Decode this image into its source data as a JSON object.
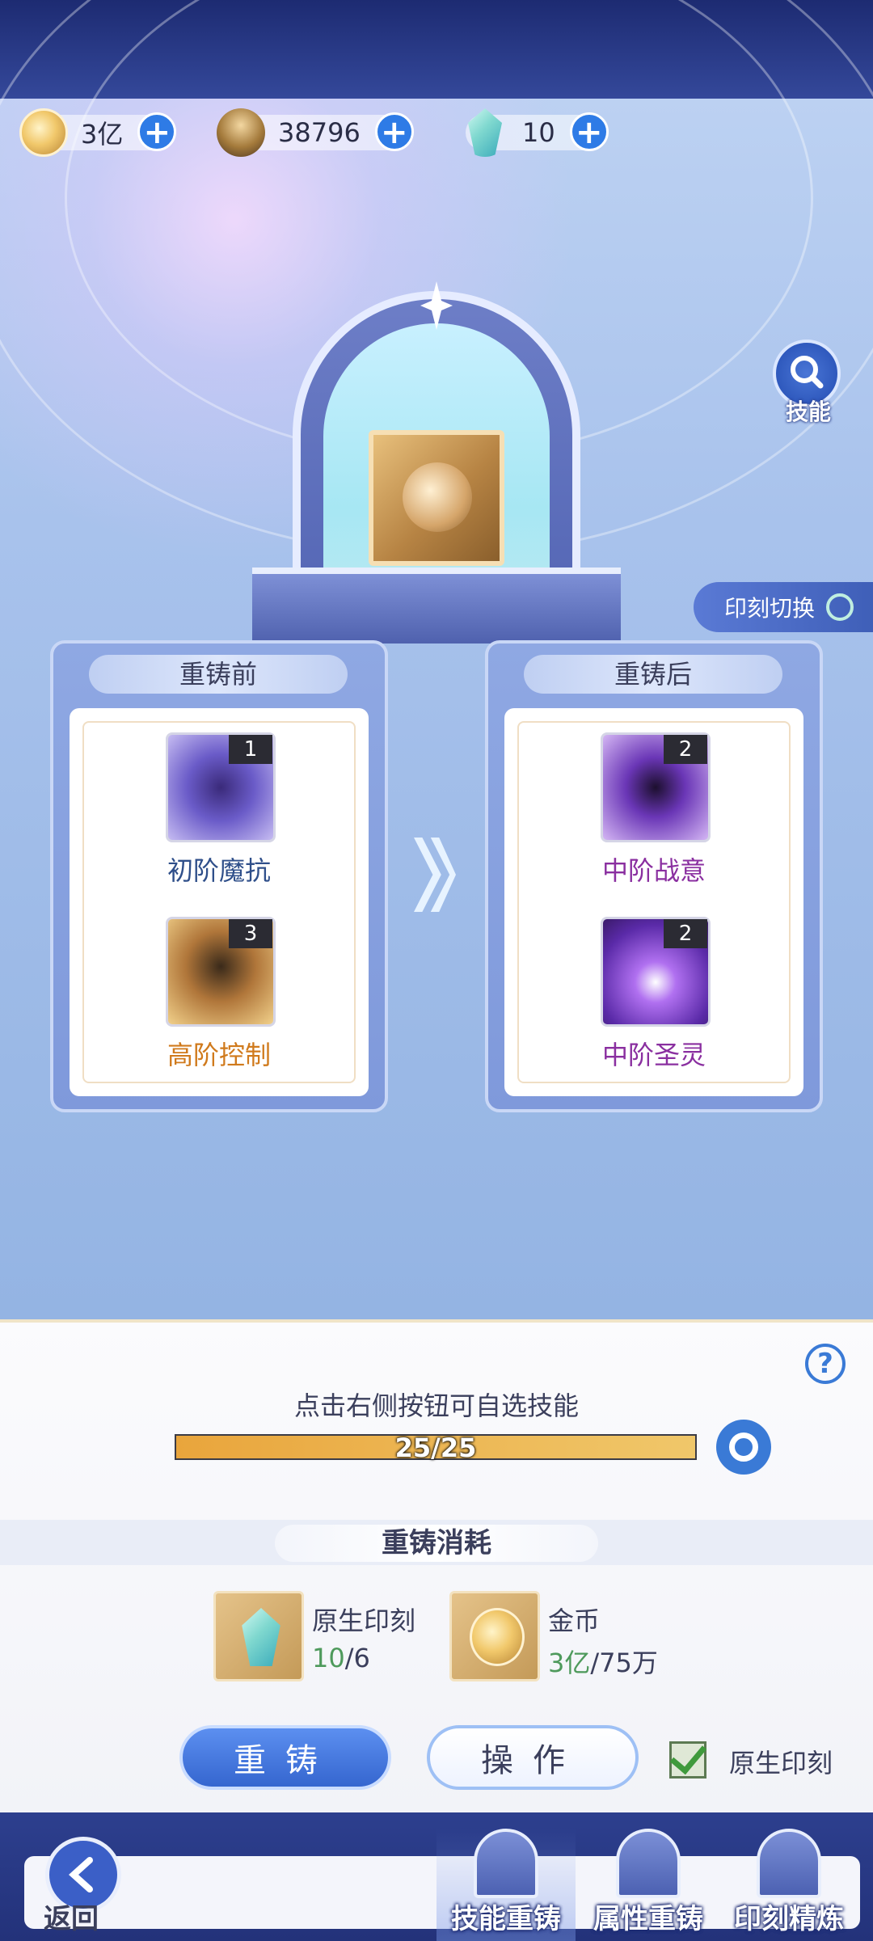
{
  "resources": [
    {
      "icon": "gold-coin-icon",
      "value": "3亿"
    },
    {
      "icon": "reforge-material-icon",
      "value": "38796"
    },
    {
      "icon": "crystal-icon",
      "value": "10"
    }
  ],
  "skill_lookup": {
    "label": "技能"
  },
  "imprint_switch": {
    "label": "印刻切换"
  },
  "before": {
    "title": "重铸前",
    "skills": [
      {
        "name": "初阶魔抗",
        "level": "1",
        "color": "#2f4f8a"
      },
      {
        "name": "高阶控制",
        "level": "3",
        "color": "#d07a1c"
      }
    ]
  },
  "after": {
    "title": "重铸后",
    "skills": [
      {
        "name": "中阶战意",
        "level": "2",
        "color": "#8a2fa0"
      },
      {
        "name": "中阶圣灵",
        "level": "2",
        "color": "#8a2fa0"
      }
    ]
  },
  "select_hint": "点击右侧按钮可自选技能",
  "progress": {
    "text": "25/25",
    "fraction": 1.0
  },
  "cost": {
    "title": "重铸消耗",
    "items": [
      {
        "name": "原生印刻",
        "have": "10",
        "need": "6",
        "icon": "crystal-icon"
      },
      {
        "name": "金币",
        "have": "3亿",
        "need": "75万",
        "icon": "gold-coin-icon"
      }
    ]
  },
  "buttons": {
    "reforge": "重铸",
    "operate": "操作"
  },
  "native_imprint_checkbox": {
    "label": "原生印刻",
    "checked": true
  },
  "nav": {
    "back": "返回",
    "tabs": [
      {
        "label": "技能重铸",
        "active": true
      },
      {
        "label": "属性重铸",
        "active": false
      },
      {
        "label": "印刻精炼",
        "active": false
      }
    ]
  }
}
